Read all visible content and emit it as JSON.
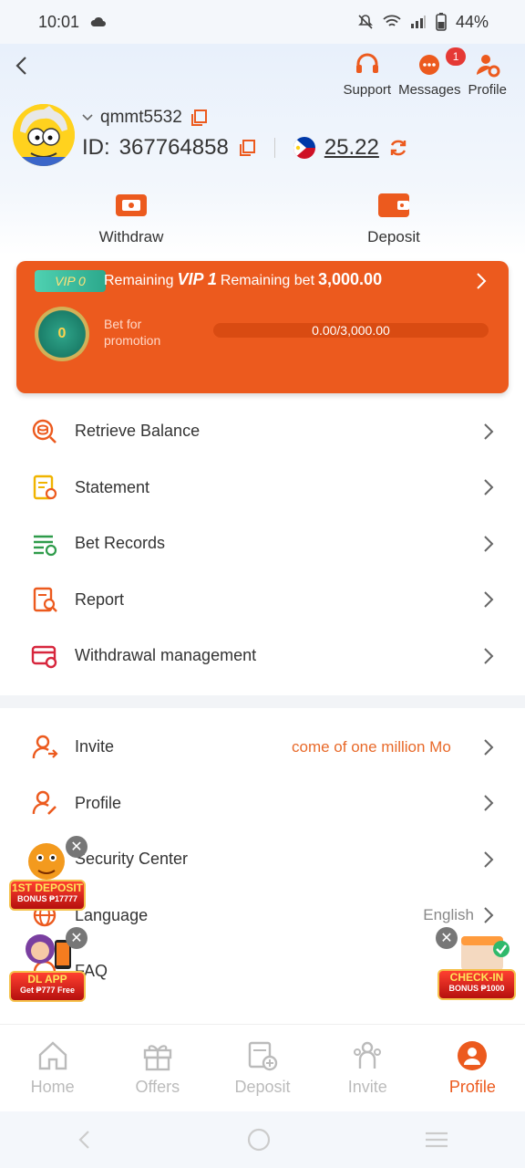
{
  "status_bar": {
    "time": "10:01",
    "battery": "44%"
  },
  "header": {
    "nav": [
      {
        "label": "Support",
        "icon": "headset-icon"
      },
      {
        "label": "Messages",
        "icon": "chat-icon",
        "badge": "1"
      },
      {
        "label": "Profile",
        "icon": "user-gear-icon"
      }
    ]
  },
  "user": {
    "username": "qmmt5532",
    "id_label": "ID:",
    "id": "367764858",
    "balance": "25.22"
  },
  "actions": {
    "withdraw": "Withdraw",
    "deposit": "Deposit"
  },
  "vip": {
    "tag": "VIP 0",
    "remaining1": "Remaining",
    "next_level": "VIP 1",
    "remaining2": "Remaining bet",
    "remaining_amount": "3,000.00",
    "medal_level": "0",
    "bet_for_promotion": "Bet for promotion",
    "progress_text": "0.00/3,000.00",
    "progress": 0
  },
  "menu_primary": [
    {
      "label": "Retrieve Balance",
      "icon": "coin-search-icon"
    },
    {
      "label": "Statement",
      "icon": "document-icon"
    },
    {
      "label": "Bet Records",
      "icon": "list-records-icon"
    },
    {
      "label": "Report",
      "icon": "report-search-icon"
    },
    {
      "label": "Withdrawal management",
      "icon": "card-gear-icon"
    }
  ],
  "menu_secondary": [
    {
      "label": "Invite",
      "icon": "invite-user-icon",
      "marquee": "come of one million  Mo"
    },
    {
      "label": "Profile",
      "icon": "user-edit-icon"
    },
    {
      "label": "Security Center",
      "icon": "shield-icon"
    },
    {
      "label": "Language",
      "icon": "globe-icon",
      "value": "English"
    },
    {
      "label": "FAQ",
      "icon": "faq-icon"
    }
  ],
  "promos": {
    "first_deposit": {
      "line1": "1ST DEPOSIT",
      "line2": "BONUS ₱17777"
    },
    "dl_app": {
      "line1": "DL APP",
      "line2": "Get ₱777 Free"
    },
    "check_in": {
      "line1": "CHECK-IN",
      "line2": "BONUS ₱1000"
    }
  },
  "bottom_nav": [
    {
      "label": "Home",
      "icon": "home-icon"
    },
    {
      "label": "Offers",
      "icon": "gift-icon"
    },
    {
      "label": "Deposit",
      "icon": "deposit-icon"
    },
    {
      "label": "Invite",
      "icon": "invite-icon"
    },
    {
      "label": "Profile",
      "icon": "profile-icon",
      "active": true
    }
  ],
  "colors": {
    "accent": "#ec5a1e",
    "vip_card": "#ec5a1e",
    "text": "#333333"
  }
}
